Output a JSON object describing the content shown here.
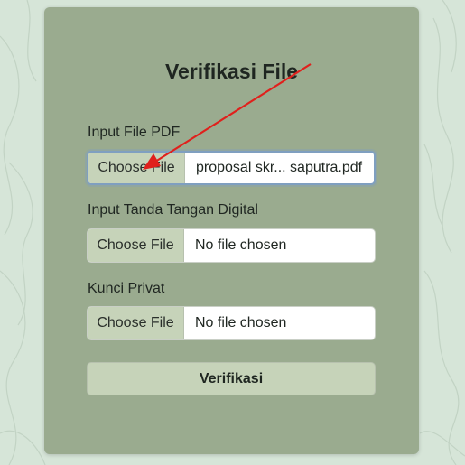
{
  "page": {
    "title": "Verifikasi File"
  },
  "fields": [
    {
      "label": "Input File PDF",
      "button_label": "Choose File",
      "file_name": "proposal skr... saputra.pdf"
    },
    {
      "label": "Input Tanda Tangan Digital",
      "button_label": "Choose File",
      "file_name": "No file chosen"
    },
    {
      "label": "Kunci Privat",
      "button_label": "Choose File",
      "file_name": "No file chosen"
    }
  ],
  "submit": {
    "label": "Verifikasi"
  },
  "colors": {
    "background": "#d6e5d8",
    "card": "#9aab8f",
    "button": "#c6d3b9",
    "annotation_arrow": "#e0201c",
    "focus_ring": "#7f9fc0"
  }
}
